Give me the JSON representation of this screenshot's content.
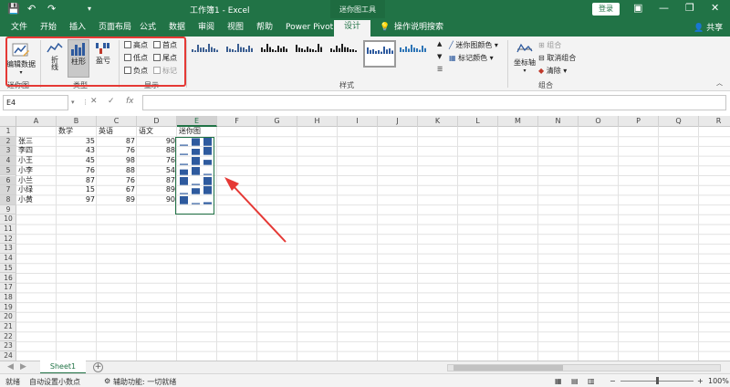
{
  "titlebar": {
    "title": "工作簿1 - Excel",
    "context_tab": "迷你图工具",
    "login": "登录",
    "qa_save": "💾",
    "qa_undo": "↶",
    "qa_redo": "↷",
    "qa_more": "▾"
  },
  "tabs": [
    {
      "label": "文件"
    },
    {
      "label": "开始"
    },
    {
      "label": "插入"
    },
    {
      "label": "页面布局"
    },
    {
      "label": "公式"
    },
    {
      "label": "数据"
    },
    {
      "label": "审阅"
    },
    {
      "label": "视图"
    },
    {
      "label": "帮助"
    },
    {
      "label": "Power Pivot"
    },
    {
      "label": "设计"
    },
    {
      "label": "操作说明搜索"
    }
  ],
  "share": "共享",
  "ribbon": {
    "sparkline_group": {
      "edit_data": "编辑数据",
      "label": "迷你图"
    },
    "type_group": {
      "line": "折线",
      "column": "柱形",
      "winloss": "盈亏",
      "label": "类型"
    },
    "show_group": {
      "high": "高点",
      "first": "首点",
      "low": "低点",
      "last": "尾点",
      "negative": "负点",
      "markers": "标记",
      "label": "显示"
    },
    "style_group": {
      "label": "样式",
      "sparkline_color": "迷你图颜色",
      "marker_color": "标记颜色"
    },
    "group_group": {
      "axis": "坐标轴",
      "group": "组合",
      "ungroup": "取消组合",
      "clear": "清除",
      "label": "组合"
    }
  },
  "formula_bar": {
    "namebox": "E4",
    "cancel": "✕",
    "enter": "✓",
    "fx": "fx"
  },
  "columns": [
    "A",
    "B",
    "C",
    "D",
    "E",
    "F",
    "G",
    "H",
    "I",
    "J",
    "K",
    "L",
    "M",
    "N",
    "O",
    "P",
    "Q",
    "R"
  ],
  "rows": [
    "1",
    "2",
    "3",
    "4",
    "5",
    "6",
    "7",
    "8",
    "9",
    "10",
    "11",
    "12",
    "13",
    "14",
    "15",
    "16",
    "17",
    "18",
    "19",
    "20",
    "21",
    "22",
    "23",
    "24"
  ],
  "table": {
    "headers": [
      "",
      "数学",
      "英语",
      "语文",
      "迷你图"
    ],
    "records": [
      {
        "name": "张三",
        "math": "35",
        "english": "87",
        "chinese": "90"
      },
      {
        "name": "李四",
        "math": "43",
        "english": "76",
        "chinese": "88"
      },
      {
        "name": "小王",
        "math": "45",
        "english": "98",
        "chinese": "76"
      },
      {
        "name": "小李",
        "math": "76",
        "english": "88",
        "chinese": "54"
      },
      {
        "name": "小兰",
        "math": "87",
        "english": "76",
        "chinese": "87"
      },
      {
        "name": "小绿",
        "math": "15",
        "english": "67",
        "chinese": "89"
      },
      {
        "name": "小黄",
        "math": "97",
        "english": "89",
        "chinese": "90"
      }
    ]
  },
  "sheet": {
    "name": "Sheet1",
    "add": "+",
    "prev": "◀",
    "next": "▶"
  },
  "status": {
    "ready": "就绪",
    "auto_decimal": "自动设置小数点",
    "accessibility": "辅助功能: 一切就绪",
    "zoom": "100%"
  },
  "colors": {
    "accent": "#217346",
    "sparkline": "#2e5a9e",
    "highlight": "#e53935"
  }
}
